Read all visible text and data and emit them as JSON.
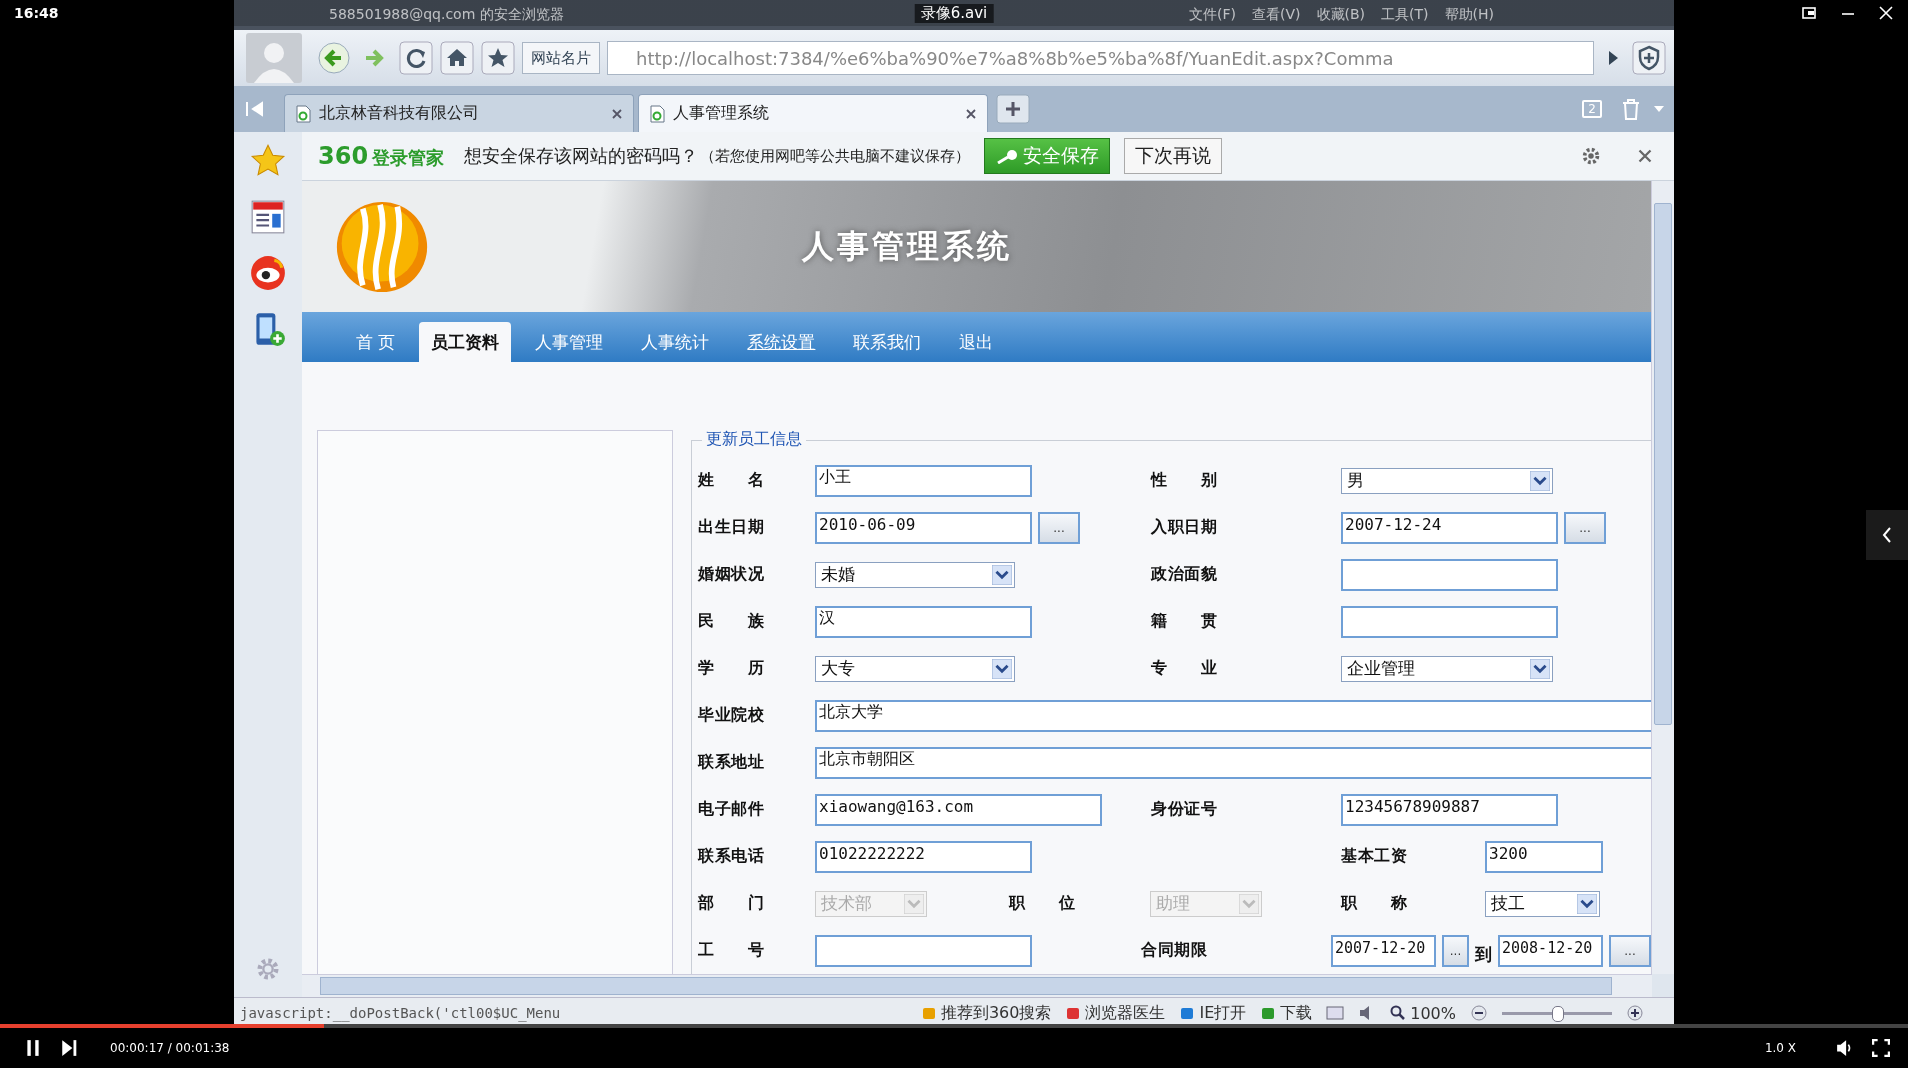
{
  "player": {
    "clock": "16:48",
    "title": "录像6.avi",
    "time": "00:00:17 / 00:01:38",
    "speed": "1.0 X",
    "progress": {
      "level": 0.17
    }
  },
  "browser": {
    "window_title": "588501988@qq.com 的安全浏览器",
    "menu": [
      "文件(F)",
      "查看(V)",
      "收藏(B)",
      "工具(T)",
      "帮助(H)"
    ],
    "site_card": "网站名片",
    "address": "http://localhost:7384/%e6%ba%90%e7%a8%8b%e5%ba%8f/YuanEdit.aspx?Comma",
    "tabs": [
      {
        "label": "北京林音科技有限公司",
        "selected": false
      },
      {
        "label": "人事管理系统",
        "selected": true
      }
    ],
    "tab_count": "2",
    "password_bar": {
      "brand_number": "360",
      "brand": "登录管家",
      "message": "想安全保存该网站的密码吗？",
      "note": "（若您使用网吧等公共电脑不建议保存）",
      "save": "安全保存",
      "later": "下次再说"
    },
    "status_bar": {
      "text": "javascript:__doPostBack('ctl00$UC_Menu",
      "items": [
        "推荐到360搜索",
        "浏览器医生",
        "IE打开",
        "下载"
      ],
      "zoom": "100%",
      "zoom_slider": {
        "level": 0.5
      }
    }
  },
  "page": {
    "title": "人事管理系统",
    "nav": [
      {
        "label": "首 页",
        "selected": false,
        "hover": false
      },
      {
        "label": "员工资料",
        "selected": true,
        "hover": false
      },
      {
        "label": "人事管理",
        "selected": false,
        "hover": false
      },
      {
        "label": "人事统计",
        "selected": false,
        "hover": false
      },
      {
        "label": "系统设置",
        "selected": false,
        "hover": true
      },
      {
        "label": "联系我们",
        "selected": false,
        "hover": false
      },
      {
        "label": "退出",
        "selected": false,
        "hover": false
      }
    ],
    "form": {
      "legend": "更新员工信息",
      "rows": [
        {
          "kind": "pair",
          "cells": [
            {
              "label": "姓 名",
              "kind": "text",
              "value": "小王",
              "disabled": false
            },
            {
              "label": "性 别",
              "kind": "select",
              "value": "男",
              "disabled": false
            }
          ]
        },
        {
          "kind": "pair",
          "cells": [
            {
              "label": "出生日期",
              "kind": "date",
              "value": "2010-06-09",
              "button": "...",
              "disabled": false
            },
            {
              "label": "入职日期",
              "kind": "date",
              "value": "2007-12-24",
              "button": "...",
              "disabled": false
            }
          ]
        },
        {
          "kind": "pair",
          "cells": [
            {
              "label": "婚姻状况",
              "kind": "select",
              "value": "未婚",
              "disabled": false
            },
            {
              "label": "政治面貌",
              "kind": "text",
              "disabled": false
            }
          ]
        },
        {
          "kind": "pair",
          "cells": [
            {
              "label": "民 族",
              "kind": "text",
              "value": "汉",
              "disabled": false
            },
            {
              "label": "籍 贯",
              "kind": "text",
              "disabled": false
            }
          ]
        },
        {
          "kind": "pair",
          "cells": [
            {
              "label": "学 历",
              "kind": "select",
              "value": "大专",
              "disabled": false
            },
            {
              "label": "专 业",
              "kind": "select",
              "value": "企业管理",
              "disabled": false
            }
          ]
        },
        {
          "kind": "wide",
          "cells": [
            {
              "label": "毕业院校",
              "kind": "wide",
              "value": "北京大学",
              "disabled": false
            }
          ]
        },
        {
          "kind": "wide",
          "cells": [
            {
              "label": "联系地址",
              "kind": "wide",
              "value": "北京市朝阳区",
              "disabled": false
            }
          ]
        },
        {
          "kind": "pair",
          "cells": [
            {
              "label": "电子邮件",
              "kind": "email",
              "value": "xiaowang@163.com",
              "disabled": false
            },
            {
              "label": "身份证号",
              "kind": "text",
              "value": "12345678909887",
              "disabled": false
            }
          ]
        },
        {
          "kind": "offset",
          "cells": [
            {
              "label": "联系电话",
              "kind": "text",
              "value": "01022222222",
              "disabled": false
            },
            {
              "label": "基本工资",
              "kind": "short",
              "value": "3200",
              "disabled": false
            }
          ]
        },
        {
          "kind": "triple",
          "cells": [
            {
              "label": "部 门",
              "kind": "select",
              "value": "技术部",
              "disabled": true
            },
            {
              "label": "职 位",
              "kind": "select",
              "value": "助理",
              "disabled": true
            },
            {
              "label": "职 称",
              "kind": "select",
              "value": "技工",
              "disabled": false
            }
          ]
        },
        {
          "kind": "pair",
          "cells": [
            {
              "label": "工 号",
              "kind": "text",
              "disabled": false
            },
            {
              "label": "合同期限",
              "kind": "range",
              "value": "2007-12-20",
              "to": "到",
              "value_end": "2008-12-20",
              "button": "...",
              "disabled": false
            }
          ]
        }
      ]
    }
  }
}
